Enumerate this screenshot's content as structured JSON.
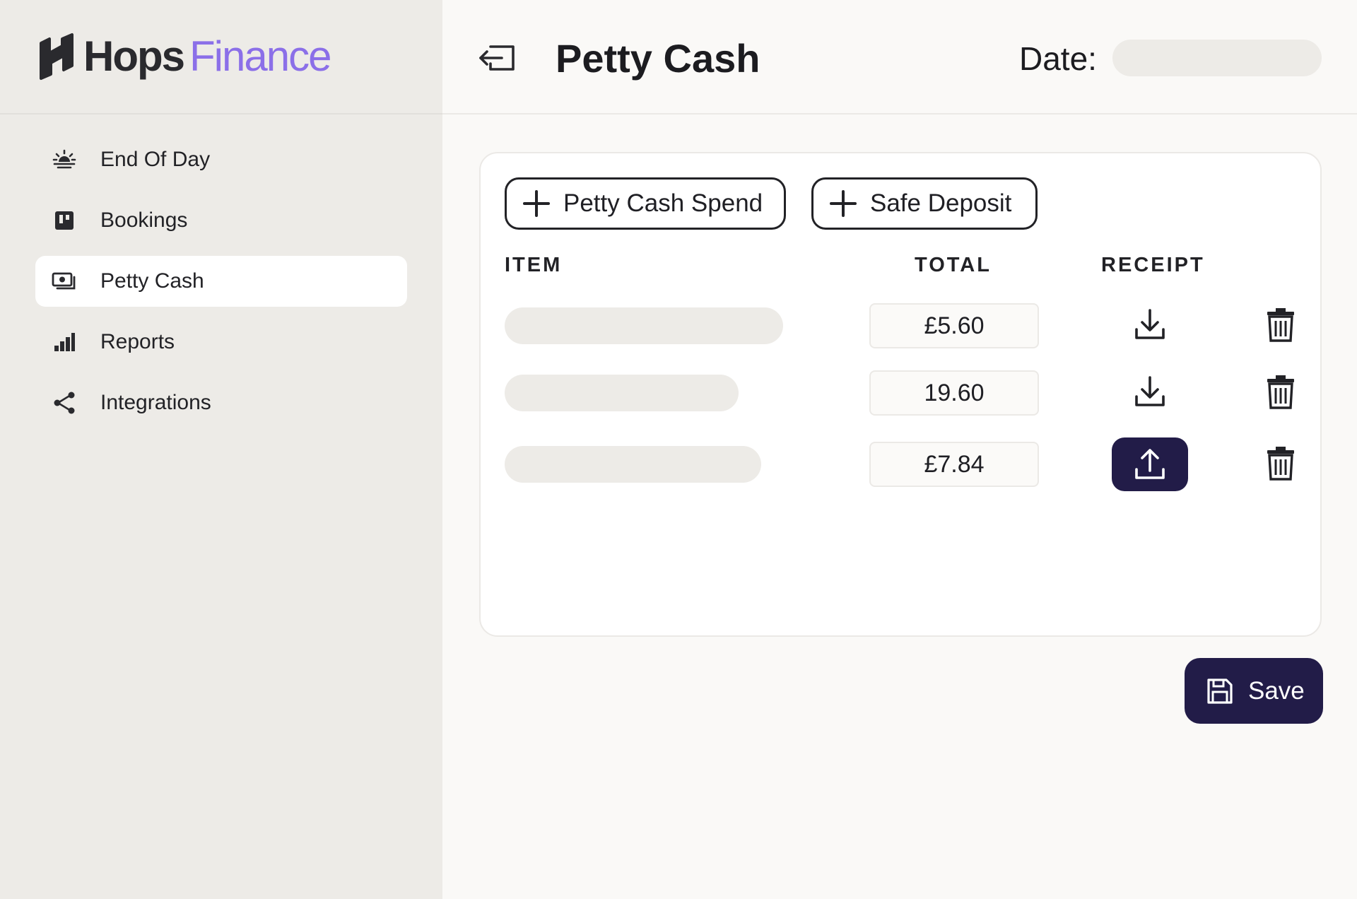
{
  "brand": {
    "name_primary": "Hops",
    "name_secondary": "Finance",
    "accent": "#8b6fe8",
    "dark": "#221c48"
  },
  "sidebar": {
    "items": [
      {
        "label": "End Of Day",
        "icon": "sunrise-icon",
        "active": false
      },
      {
        "label": "Bookings",
        "icon": "bookings-icon",
        "active": false
      },
      {
        "label": "Petty Cash",
        "icon": "cash-icon",
        "active": true
      },
      {
        "label": "Reports",
        "icon": "bar-chart-icon",
        "active": false
      },
      {
        "label": "Integrations",
        "icon": "share-icon",
        "active": false
      }
    ]
  },
  "header": {
    "title": "Petty Cash",
    "date_label": "Date:",
    "date_value": ""
  },
  "actions": {
    "petty_cash_spend": "Petty Cash Spend",
    "safe_deposit": "Safe Deposit",
    "save": "Save"
  },
  "table": {
    "columns": [
      "ITEM",
      "TOTAL",
      "RECEIPT"
    ],
    "rows": [
      {
        "item": "",
        "total": "£5.60",
        "receipt": "download-icon"
      },
      {
        "item": "",
        "total": "19.60",
        "receipt": "download-icon"
      },
      {
        "item": "",
        "total": "£7.84",
        "receipt": "upload-icon"
      }
    ]
  }
}
